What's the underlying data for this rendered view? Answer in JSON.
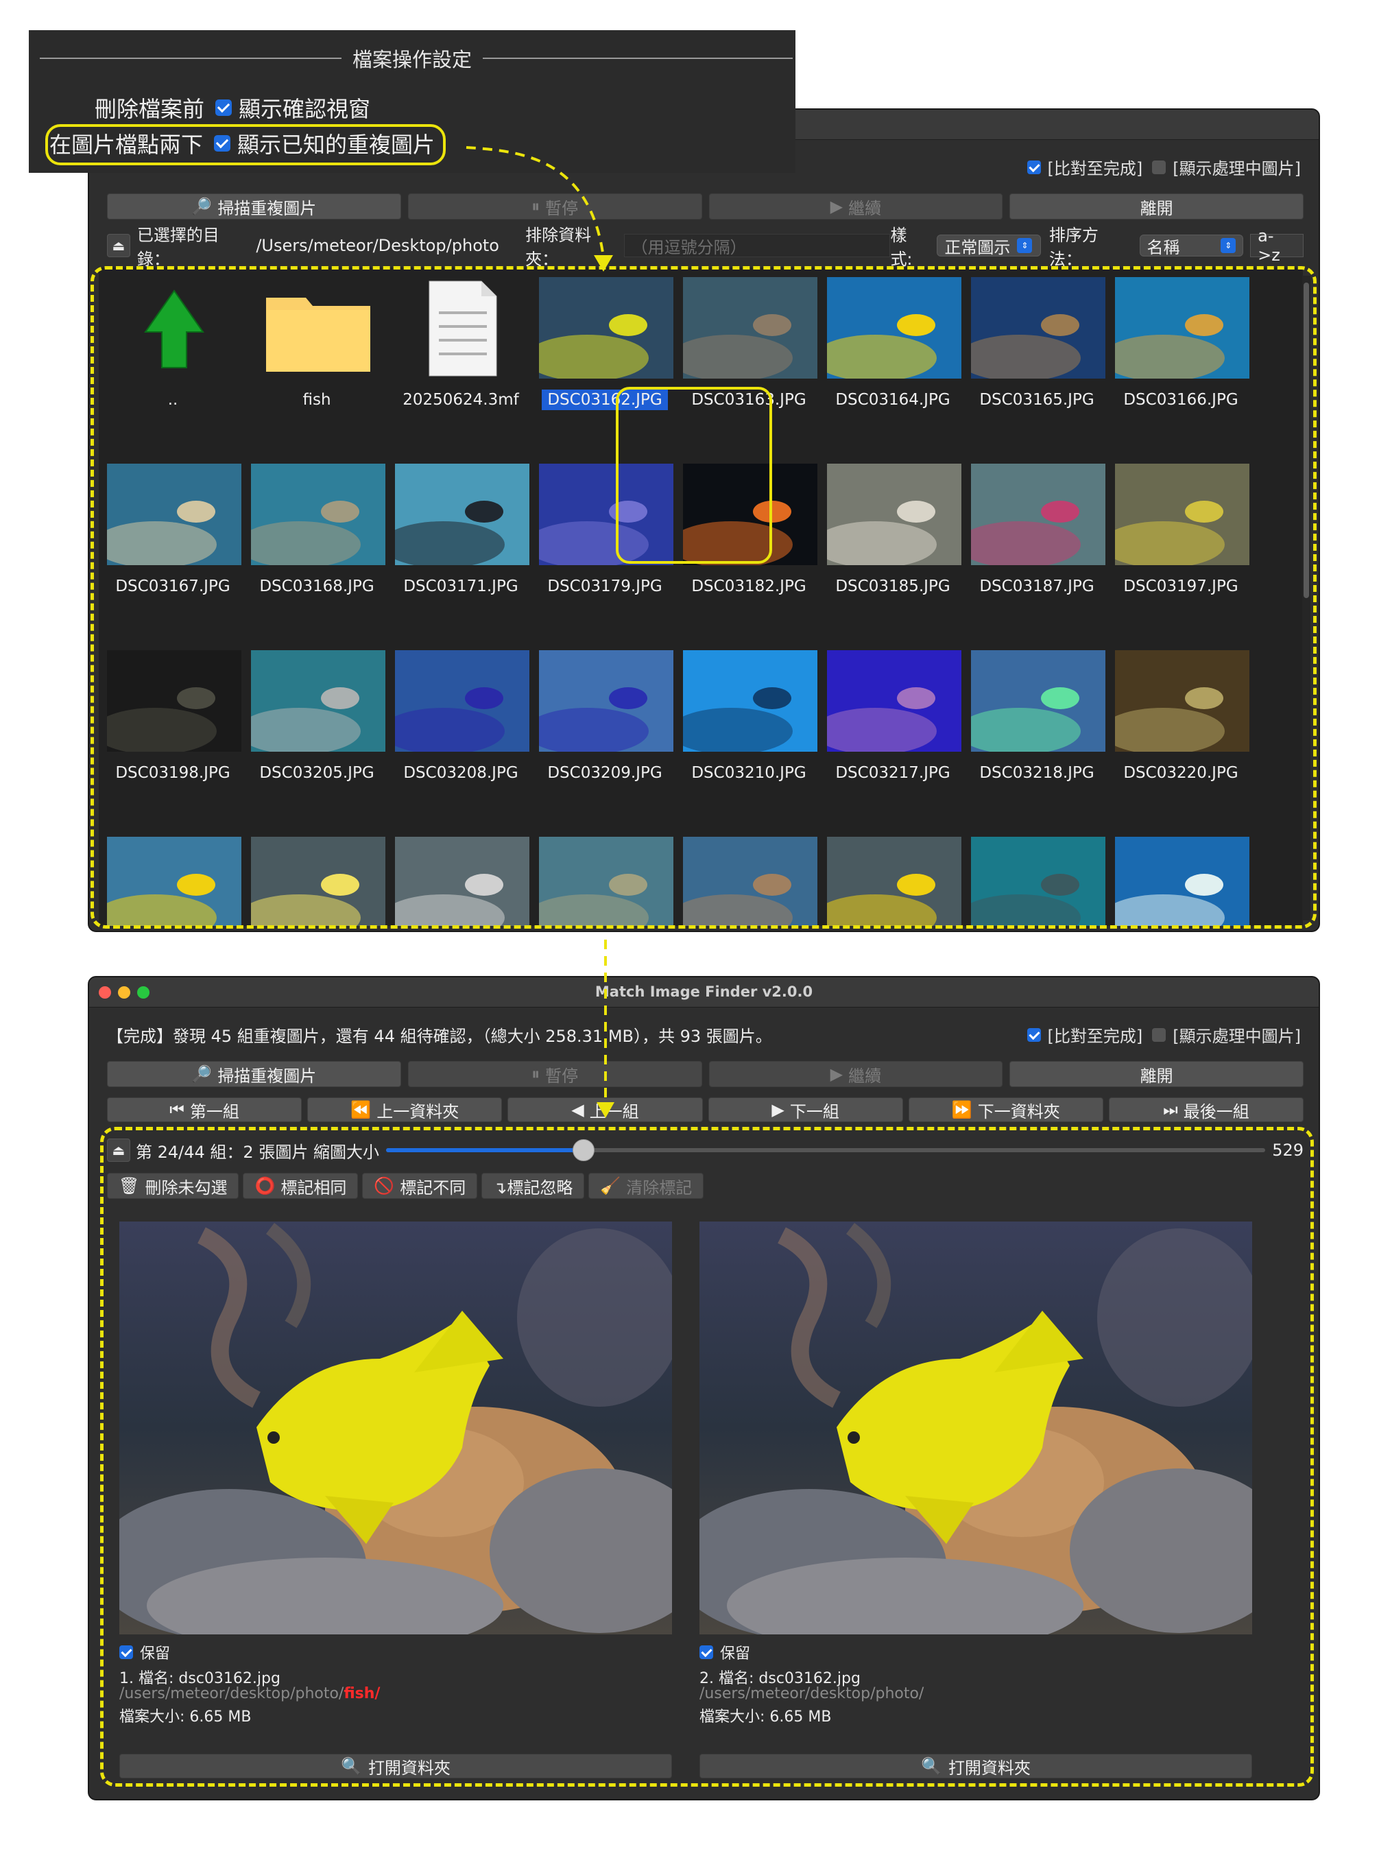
{
  "settings": {
    "title": "檔案操作設定",
    "row1_label": "刪除檔案前",
    "row1_check": "顯示確認視窗",
    "row2_label": "在圖片檔點兩下",
    "row2_check": "顯示已知的重複圖片"
  },
  "colors": {
    "accent": "#1e6ce0",
    "highlight": "#ece40c",
    "path_highlight": "#ff2a2a"
  },
  "top_window": {
    "checks": {
      "compare_done": "[比對至完成]",
      "show_processing": "[顯示處理中圖片]"
    },
    "buttons": {
      "scan": "掃描重複圖片",
      "pause": "暫停",
      "continue": "繼續",
      "exit": "離開"
    },
    "dir_label": "已選擇的目錄：",
    "dir_path": "/Users/meteor/Desktop/photo",
    "exclude_label": "排除資料夾：",
    "exclude_placeholder": "（用逗號分隔）",
    "style_label": "樣式:",
    "style_value": "正常圖示",
    "sort_label": "排序方法：",
    "sort_value": "名稱",
    "sort_dir": "a->z",
    "items": [
      {
        "name": "..",
        "kind": "up-arrow"
      },
      {
        "name": "fish",
        "kind": "folder"
      },
      {
        "name": "20250624.3mf",
        "kind": "document"
      },
      {
        "name": "DSC03162.JPG",
        "kind": "photo",
        "selected": true,
        "c1": "#2d4a62",
        "c2": "#d8d820"
      },
      {
        "name": "DSC03163.JPG",
        "kind": "photo",
        "c1": "#3a5a6a",
        "c2": "#8a7a66"
      },
      {
        "name": "DSC03164.JPG",
        "kind": "photo",
        "c1": "#1a6fb0",
        "c2": "#f0d010"
      },
      {
        "name": "DSC03165.JPG",
        "kind": "photo",
        "c1": "#1b3d70",
        "c2": "#9a7a50"
      },
      {
        "name": "DSC03166.JPG",
        "kind": "photo",
        "c1": "#1a7ab0",
        "c2": "#d2a040"
      },
      {
        "name": "DSC03167.JPG",
        "kind": "photo",
        "c1": "#2f6f8f",
        "c2": "#cfc4a0"
      },
      {
        "name": "DSC03168.JPG",
        "kind": "photo",
        "c1": "#2f7f9a",
        "c2": "#a09a80"
      },
      {
        "name": "DSC03171.JPG",
        "kind": "photo",
        "c1": "#4a9ab8",
        "c2": "#202830"
      },
      {
        "name": "DSC03179.JPG",
        "kind": "photo",
        "c1": "#2a3aa0",
        "c2": "#7070d0"
      },
      {
        "name": "DSC03182.JPG",
        "kind": "photo",
        "c1": "#0c0f14",
        "c2": "#e06a20"
      },
      {
        "name": "DSC03185.JPG",
        "kind": "photo",
        "c1": "#777a70",
        "c2": "#d8d4c8"
      },
      {
        "name": "DSC03187.JPG",
        "kind": "photo",
        "c1": "#5a7a80",
        "c2": "#c04070"
      },
      {
        "name": "DSC03197.JPG",
        "kind": "photo",
        "c1": "#6a6a50",
        "c2": "#d0c040"
      },
      {
        "name": "DSC03198.JPG",
        "kind": "photo",
        "c1": "#1a1a1a",
        "c2": "#4a4a40"
      },
      {
        "name": "DSC03205.JPG",
        "kind": "photo",
        "c1": "#2a7a8a",
        "c2": "#aab0b0"
      },
      {
        "name": "DSC03208.JPG",
        "kind": "photo",
        "c1": "#2a56a0",
        "c2": "#2a2aa8"
      },
      {
        "name": "DSC03209.JPG",
        "kind": "photo",
        "c1": "#4070b0",
        "c2": "#2a30b0"
      },
      {
        "name": "DSC03210.JPG",
        "kind": "photo",
        "c1": "#2090e0",
        "c2": "#104070"
      },
      {
        "name": "DSC03217.JPG",
        "kind": "photo",
        "c1": "#2a20c0",
        "c2": "#a070c0"
      },
      {
        "name": "DSC03218.JPG",
        "kind": "photo",
        "c1": "#3a6aa0",
        "c2": "#60e0a0"
      },
      {
        "name": "DSC03220.JPG",
        "kind": "photo",
        "c1": "#4a3a20",
        "c2": "#b0a060"
      },
      {
        "name": "",
        "kind": "photo",
        "c1": "#3a7aa0",
        "c2": "#f0d010"
      },
      {
        "name": "",
        "kind": "photo",
        "c1": "#4a5a60",
        "c2": "#f0e060"
      },
      {
        "name": "",
        "kind": "photo",
        "c1": "#5a6a70",
        "c2": "#d0d0d0"
      },
      {
        "name": "",
        "kind": "photo",
        "c1": "#4a7a8a",
        "c2": "#a0a080"
      },
      {
        "name": "",
        "kind": "photo",
        "c1": "#3a6a90",
        "c2": "#a08060"
      },
      {
        "name": "",
        "kind": "photo",
        "c1": "#4a5a60",
        "c2": "#f0d010"
      },
      {
        "name": "",
        "kind": "photo",
        "c1": "#1a7a8a",
        "c2": "#3a5a60"
      },
      {
        "name": "",
        "kind": "photo",
        "c1": "#1a6ab0",
        "c2": "#e0f0f0"
      }
    ]
  },
  "bottom_window": {
    "title": "Match Image Finder v2.0.0",
    "status": "【完成】發現 45 組重複圖片，還有 44 組待確認，（總大小 258.31 MB），共 93 張圖片。",
    "checks": {
      "compare_done": "[比對至完成]",
      "show_processing": "[顯示處理中圖片]"
    },
    "buttons": {
      "scan": "掃描重複圖片",
      "pause": "暫停",
      "continue": "繼續",
      "exit": "離開"
    },
    "nav": {
      "first": "第一組",
      "prev_folder": "上一資料夾",
      "prev": "上一組",
      "next": "下一組",
      "next_folder": "下一資料夾",
      "last": "最後一組"
    },
    "group_label": "第 24/44 組：2 張圖片 縮圖大小",
    "thumb_size": "529",
    "thumb_size_fraction": 0.225,
    "actions": {
      "delete_unchecked": "刪除未勾選",
      "mark_same": "標記相同",
      "mark_different": "標記不同",
      "mark_ignore": "↴標記忽略",
      "clear_mark": "清除標記"
    },
    "images": [
      {
        "keep": "保留",
        "name": "1. 檔名: dsc03162.jpg",
        "path_prefix": "/users/meteor/desktop/photo/",
        "path_highlight": "fish/",
        "size": "檔案大小: 6.65 MB",
        "open": "打開資料夾"
      },
      {
        "keep": "保留",
        "name": "2. 檔名: dsc03162.jpg",
        "path_prefix": "/users/meteor/desktop/photo/",
        "path_highlight": "",
        "size": "檔案大小: 6.65 MB",
        "open": "打開資料夾"
      }
    ]
  }
}
